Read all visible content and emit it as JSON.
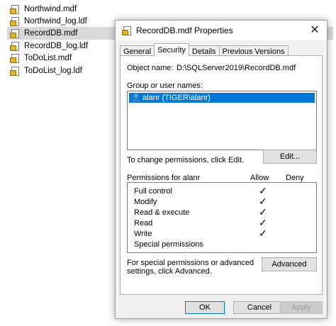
{
  "explorer": {
    "files": [
      {
        "name": "Northwind.mdf",
        "selected": false,
        "icon": "database-file-icon"
      },
      {
        "name": "Northwind_log.ldf",
        "selected": false,
        "icon": "database-file-icon"
      },
      {
        "name": "RecordDB.mdf",
        "selected": true,
        "icon": "database-file-icon"
      },
      {
        "name": "RecordDB_log.ldf",
        "selected": false,
        "icon": "database-file-icon"
      },
      {
        "name": "ToDoList.mdf",
        "selected": false,
        "icon": "database-file-icon"
      },
      {
        "name": "ToDoList_log.ldf",
        "selected": false,
        "icon": "database-file-icon"
      }
    ]
  },
  "dialog": {
    "title": "RecordDB.mdf Properties",
    "close_icon": "close-icon",
    "tabs": [
      {
        "label": "General",
        "active": false
      },
      {
        "label": "Security",
        "active": true
      },
      {
        "label": "Details",
        "active": false
      },
      {
        "label": "Previous Versions",
        "active": false
      }
    ],
    "security": {
      "object_name_label": "Object name:",
      "object_name_value": "D:\\SQLServer2019\\RecordDB.mdf",
      "group_label": "Group or user names:",
      "users": [
        {
          "name": "alanr (TIGER\\alanr)",
          "selected": true,
          "icon": "user-icon"
        }
      ],
      "change_text": "To change permissions, click Edit.",
      "edit_button": "Edit...",
      "permissions_label": "Permissions for alanr",
      "allow_header": "Allow",
      "deny_header": "Deny",
      "permissions": [
        {
          "name": "Full control",
          "allow": true,
          "deny": false
        },
        {
          "name": "Modify",
          "allow": true,
          "deny": false
        },
        {
          "name": "Read & execute",
          "allow": true,
          "deny": false
        },
        {
          "name": "Read",
          "allow": true,
          "deny": false
        },
        {
          "name": "Write",
          "allow": true,
          "deny": false
        },
        {
          "name": "Special permissions",
          "allow": false,
          "deny": false
        }
      ],
      "special_text": "For special permissions or advanced settings, click Advanced.",
      "advanced_button": "Advanced"
    },
    "footer": {
      "ok": "OK",
      "cancel": "Cancel",
      "apply": "Apply",
      "apply_enabled": false
    },
    "colors": {
      "selection": "#0078d7",
      "dialog_bg": "#f0f0f0",
      "file_selected_bg": "#d9d9d9"
    }
  }
}
